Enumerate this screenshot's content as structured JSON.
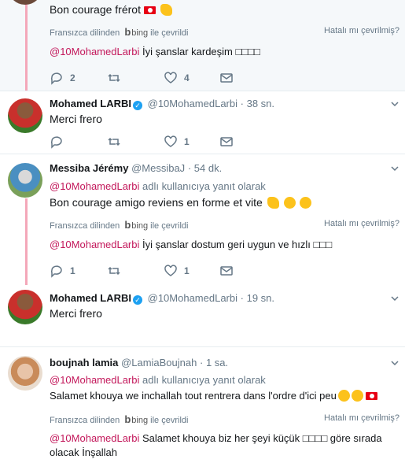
{
  "translation": {
    "from_label": "Fransızca dilinden",
    "bing_label": "bing",
    "suffix_label": "ile çevrildi",
    "wrong_label": "Hatalı mı çevrilmiş?"
  },
  "tweet0": {
    "text": "Bon courage frérot",
    "emojis": [
      "tunisia-flag",
      "flexed-biceps"
    ],
    "translated": "İyi şanslar kardeşim □□□□",
    "mention": "@10MohamedLarbi",
    "replies": "2",
    "likes": "4"
  },
  "tweet1": {
    "name": "Mohamed LARBI",
    "handle": "@10MohamedLarbi",
    "dot": "·",
    "time": "38 sn.",
    "text": "Merci frero",
    "likes": "1"
  },
  "tweet2": {
    "name": "Messiba Jérémy",
    "handle": "@MessibaJ",
    "dot": "·",
    "time": "54 dk.",
    "reply_mention": "@10MohamedLarbi",
    "reply_suffix": "adlı kullanıcıya yanıt olarak",
    "text": "Bon courage amigo reviens en forme et vite",
    "emojis": [
      "flexed-biceps",
      "hugging-face",
      "winking-face"
    ],
    "mention": "@10MohamedLarbi",
    "translated": "İyi şanslar dostum geri uygun ve hızlı □□□",
    "replies": "1",
    "likes": "1"
  },
  "tweet3": {
    "name": "Mohamed LARBI",
    "handle": "@10MohamedLarbi",
    "dot": "·",
    "time": "19 sn.",
    "text": "Merci frero"
  },
  "tweet4": {
    "name": "boujnah lamia",
    "handle": "@LamiaBoujnah",
    "dot": "·",
    "time": "1 sa.",
    "reply_mention": "@10MohamedLarbi",
    "reply_suffix": "adlı kullanıcıya yanıt olarak",
    "text": "Salamet khouya we inchallah tout rentrera dans l'ordre d'ici peu",
    "emojis": [
      "winking-face",
      "winking-face",
      "tunisia-flag"
    ],
    "mention": "@10MohamedLarbi",
    "translated_line1": "Salamet khouya biz her şeyi küçük □□□□ göre sırada",
    "translated_line2": "olacak İnşallah"
  },
  "colors": {
    "accent": "#1da1f2",
    "mention": "#c3185b",
    "thread_line": "#f4a7b9",
    "muted": "#657786"
  }
}
